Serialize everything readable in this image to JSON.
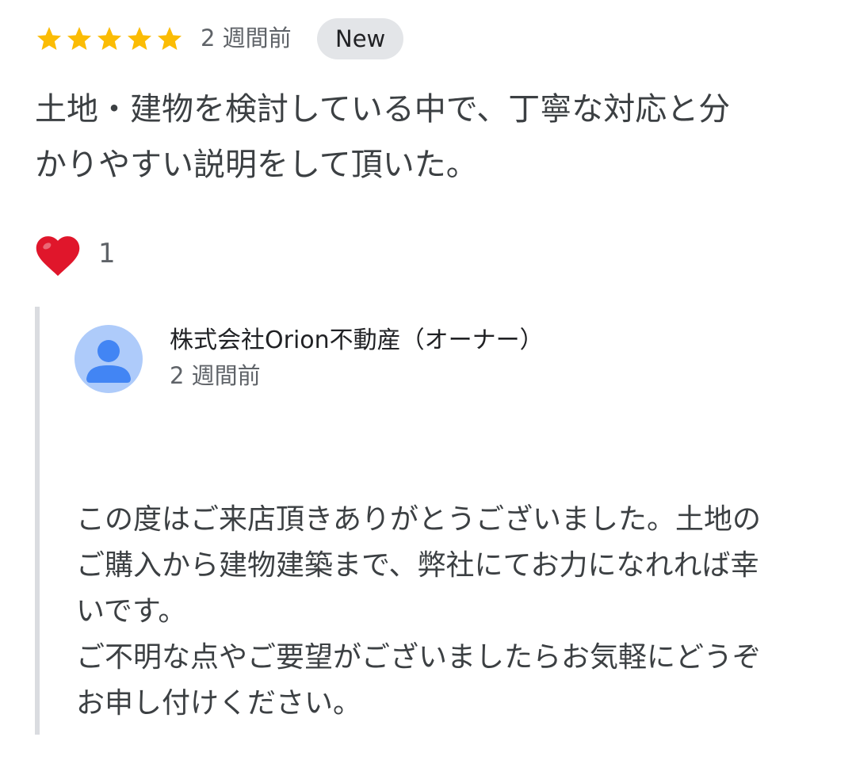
{
  "review": {
    "rating": 5,
    "rating_max": 5,
    "time": "2 週間前",
    "badge": "New",
    "text": "土地・建物を検討している中で、丁寧な対応と分\nかりやすい説明をして頂いた。",
    "reaction_icon": "heart-icon",
    "reaction_count": "1"
  },
  "owner_reply": {
    "name": "株式会社Orion不動産（オーナー）",
    "time": "2 週間前",
    "avatar_icon": "person-avatar-icon",
    "text": "この度はご来店頂きありがとうございました。土地の\nご購入から建物建築まで、弊社にてお力になれれば幸\nいです。\nご不明な点やご要望がございましたらお気軽にどうぞ\nお申し付けください。"
  },
  "colors": {
    "star": "#fbbc04",
    "badge_bg": "#e3e5e8",
    "heart": "#e0162b",
    "avatar_bg": "#aecbfa",
    "avatar_fg": "#4285f4",
    "reply_bar": "#dadce0"
  }
}
